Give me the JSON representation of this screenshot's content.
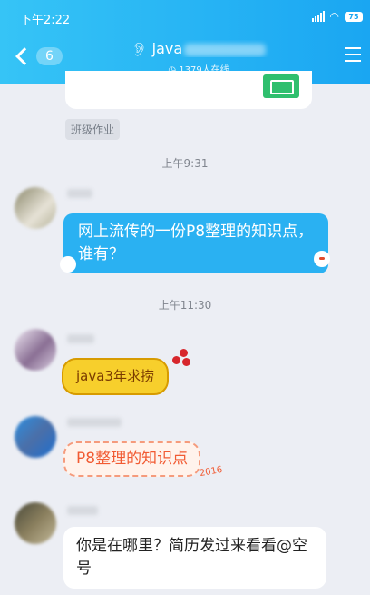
{
  "status": {
    "time": "下午2:22",
    "battery": "75"
  },
  "header": {
    "back_count": "6",
    "title": "java",
    "online": "1379人在线"
  },
  "tag_label": "班级作业",
  "timestamps": [
    "上午9:31",
    "上午11:30"
  ],
  "messages": [
    {
      "text": "网上流传的一份P8整理的知识点，谁有？"
    },
    {
      "text": "java3年求捞"
    },
    {
      "text": "P8整理的知识点",
      "sticker_text": "2016"
    },
    {
      "text": "你是在哪里？简历发过来看看@空号"
    }
  ],
  "colors": {
    "header": "#1aa6f2",
    "bubble_blue": "#2ab1f2",
    "background": "#eceef4"
  },
  "icons": {
    "menu": "hamburger-icon",
    "back": "chevron-left-icon",
    "online": "clock-icon"
  }
}
